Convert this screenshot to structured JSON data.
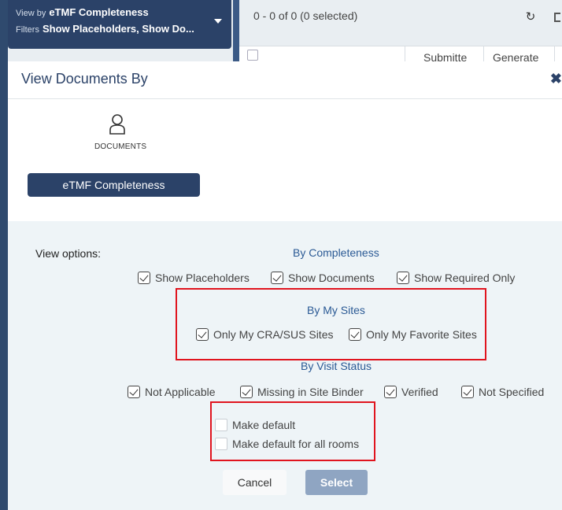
{
  "viewby": {
    "label": "View by",
    "value": "eTMF Completeness",
    "filters_label": "Filters",
    "filters_value": "Show Placeholders, Show Do..."
  },
  "toolbar": {
    "range_text": "0 - 0 of 0 (0 selected)",
    "refresh_icon": "refresh-icon",
    "columns": [
      "Submitte",
      "Generate"
    ]
  },
  "modal": {
    "title": "View Documents By",
    "close": "✖",
    "documents_label": "DOCUMENTS",
    "completeness_button": "eTMF Completeness",
    "view_options_label": "View options:",
    "sections": {
      "completeness": {
        "title": "By Completeness",
        "options": [
          {
            "label": "Show Placeholders",
            "checked": true
          },
          {
            "label": "Show Documents",
            "checked": true
          },
          {
            "label": "Show Required Only",
            "checked": true
          }
        ]
      },
      "sites": {
        "title": "By My Sites",
        "options": [
          {
            "label": "Only My CRA/SUS Sites",
            "checked": true
          },
          {
            "label": "Only My Favorite Sites",
            "checked": true
          }
        ]
      },
      "visit": {
        "title": "By Visit Status",
        "options": [
          {
            "label": "Not Applicable",
            "checked": true
          },
          {
            "label": "Missing in Site Binder",
            "checked": true
          },
          {
            "label": "Verified",
            "checked": true
          },
          {
            "label": "Not Specified",
            "checked": true
          }
        ]
      }
    },
    "defaults": [
      {
        "label": "Make default",
        "checked": false
      },
      {
        "label": "Make default for all rooms",
        "checked": false
      }
    ],
    "cancel_label": "Cancel",
    "select_label": "Select"
  },
  "colors": {
    "navy": "#2b4268",
    "highlight": "#e0141e",
    "link": "#2b5a95"
  }
}
